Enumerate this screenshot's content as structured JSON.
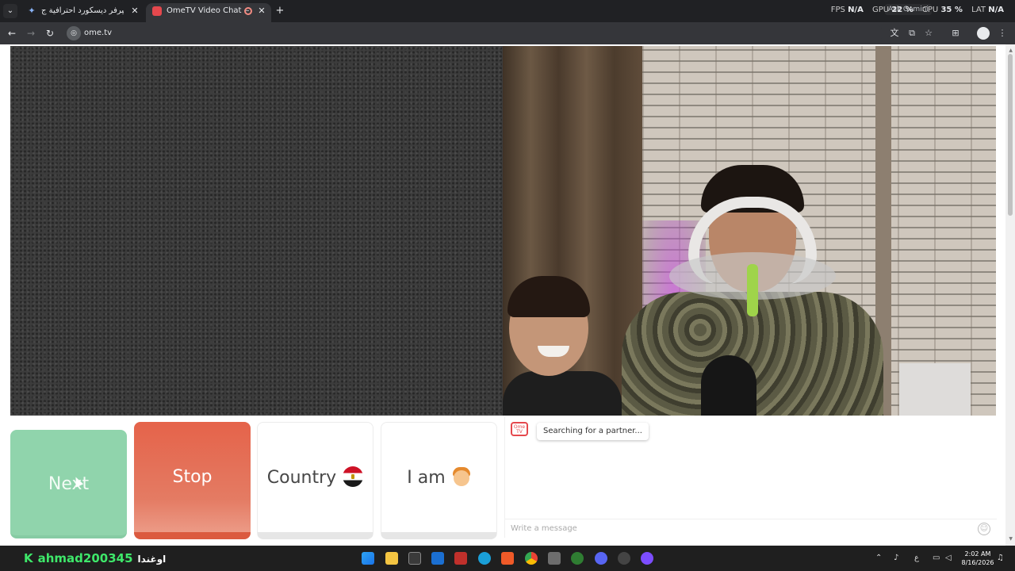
{
  "browser": {
    "tabs": [
      {
        "title": "هيكلية سيرفر ديسكورد احترافية ج"
      },
      {
        "title": "OmeTV Video Chat — Ome"
      }
    ],
    "url": "ome.tv",
    "ask_gemini": "Ask Gemini",
    "perf": {
      "fps_label": "FPS",
      "fps_value": "N/A",
      "gpu_label": "GPU",
      "gpu_value": "22 %",
      "cpu_label": "CPU",
      "cpu_value": "35 %",
      "lat_label": "LAT",
      "lat_value": "N/A"
    }
  },
  "controls": {
    "next_label": "Next",
    "stop_label": "Stop",
    "country_label": "Country",
    "iam_label": "I am"
  },
  "chat": {
    "brand_badge": "Ome TV",
    "status_message": "Searching for a partner...",
    "input_placeholder": "Write a message"
  },
  "taskbar": {
    "streamer_name": "ahmad200345",
    "streamer_arabic": "اوغندا",
    "clock_time": "2:02 AM",
    "clock_date": "8/16/2026",
    "lang": "ع"
  },
  "colors": {
    "next": "#90d4ac",
    "stop": "#e5634a",
    "brand": "#e5484d"
  }
}
